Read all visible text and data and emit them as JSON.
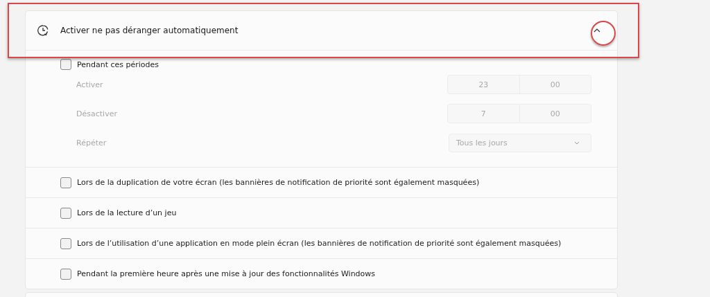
{
  "section": {
    "title": "Activer ne pas déranger automatiquement",
    "expanded": true,
    "schedule": {
      "label": "Pendant ces périodes",
      "checked": false,
      "rows": [
        {
          "kind": "time",
          "label": "Activer",
          "disabled": true,
          "hour": "23",
          "minute": "00"
        },
        {
          "kind": "time",
          "label": "Désactiver",
          "disabled": true,
          "hour": "7",
          "minute": "00"
        },
        {
          "kind": "select",
          "label": "Répéter",
          "disabled": true,
          "value": "Tous les jours"
        }
      ]
    },
    "options": [
      {
        "label": "Lors de la duplication de votre écran (les bannières de notification de priorité sont également masquées)",
        "checked": false
      },
      {
        "label": "Lors de la lecture d’un jeu",
        "checked": false
      },
      {
        "label": "Lors de l’utilisation d’une application en mode plein écran (les bannières de notification de priorité sont également masquées)",
        "checked": false
      },
      {
        "label": "Pendant la première heure après une mise à jour des fonctionnalités Windows",
        "checked": false
      }
    ]
  }
}
